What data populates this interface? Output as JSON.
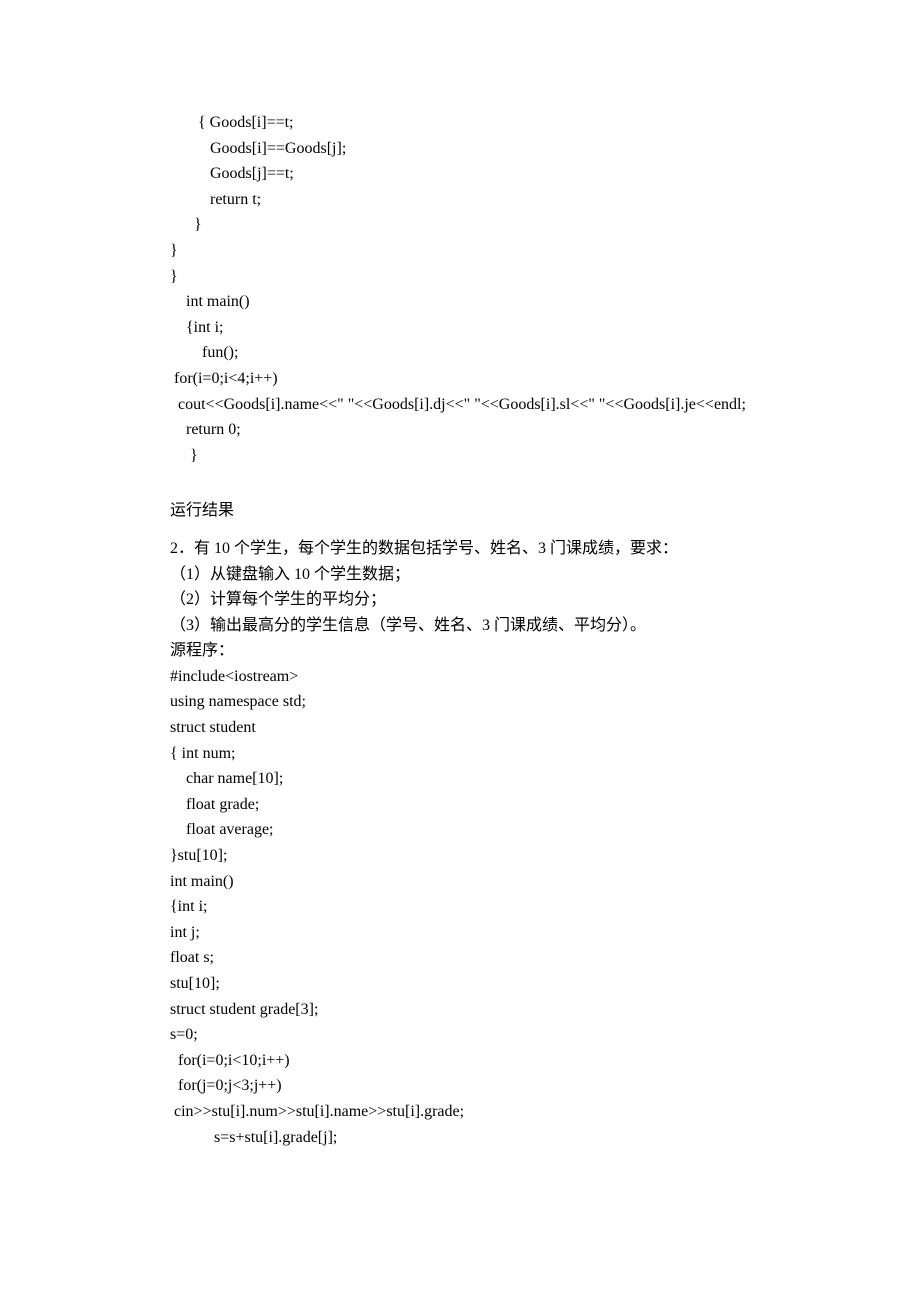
{
  "code_block_1": [
    "       { Goods[i]==t;",
    "          Goods[i]==Goods[j];",
    "          Goods[j]==t;",
    "          return t;",
    "      }",
    "",
    "}",
    "",
    "",
    "}",
    "    int main()",
    "    {int i;",
    "        fun();",
    " for(i=0;i<4;i++)",
    "  cout<<Goods[i].name<<\" \"<<Goods[i].dj<<\" \"<<Goods[i].sl<<\" \"<<Goods[i].je<<endl;",
    "    return 0;",
    "     }"
  ],
  "run_result_heading": "运行结果",
  "problem_statement": [
    "2．有 10 个学生，每个学生的数据包括学号、姓名、3 门课成绩，要求：",
    "（1）从键盘输入 10 个学生数据；",
    "（2）计算每个学生的平均分；",
    "（3）输出最高分的学生信息（学号、姓名、3 门课成绩、平均分）。"
  ],
  "source_label": "源程序：",
  "code_block_2": [
    "#include<iostream>",
    "using namespace std;",
    "struct student",
    "{ int num;",
    "    char name[10];",
    "    float grade;",
    "    float average;",
    "}stu[10];",
    "int main()",
    "{int i;",
    "int j;",
    "float s;",
    "stu[10];",
    "struct student grade[3];",
    "s=0;",
    "  for(i=0;i<10;i++)",
    "  for(j=0;j<3;j++)",
    " cin>>stu[i].num>>stu[i].name>>stu[i].grade;",
    "           s=s+stu[i].grade[j];"
  ]
}
